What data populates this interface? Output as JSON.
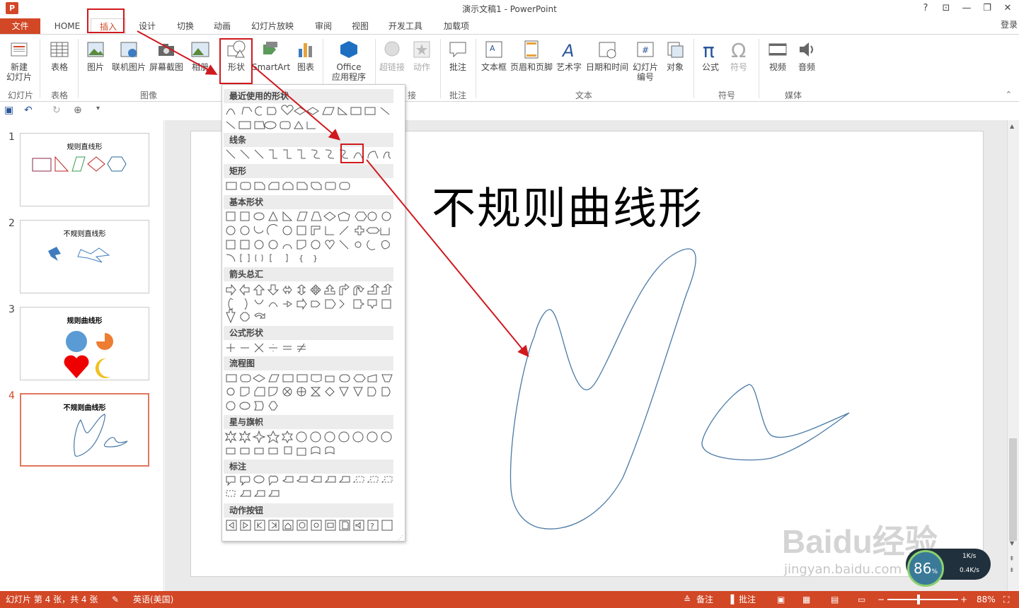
{
  "titlebar": {
    "app_icon": "P",
    "title": "演示文稿1 - PowerPoint",
    "help": "?",
    "restore_ribbon": "⊡",
    "minimize": "—",
    "maximize": "❐",
    "close": "✕"
  },
  "tabs": {
    "file": "文件",
    "home": "HOME",
    "insert": "插入",
    "design": "设计",
    "transitions": "切换",
    "animations": "动画",
    "slideshow": "幻灯片放映",
    "review": "审阅",
    "view": "视图",
    "developer": "开发工具",
    "addins": "加载项",
    "login": "登录"
  },
  "ribbon": {
    "new_slide": "新建",
    "new_slide2": "幻灯片",
    "table": "表格",
    "picture": "图片",
    "online_picture": "联机图片",
    "screenshot": "屏幕截图",
    "album": "相册",
    "shapes": "形状",
    "smartart": "SmartArt",
    "chart": "图表",
    "office_app": "Office",
    "office_app2": "应用程序",
    "hyperlink": "超链接",
    "action": "动作",
    "comment": "批注",
    "textbox": "文本框",
    "header_footer": "页眉和页脚",
    "wordart": "艺术字",
    "datetime": "日期和时间",
    "slide_number": "幻灯片",
    "slide_number2": "编号",
    "object": "对象",
    "equation": "公式",
    "symbol": "符号",
    "video": "视频",
    "audio": "音频",
    "groups": {
      "slides": "幻灯片",
      "tables": "表格",
      "images": "图像",
      "links": "接",
      "comments": "批注",
      "text": "文本",
      "symbols": "符号",
      "media": "媒体"
    }
  },
  "shapes_panel": {
    "sections": [
      "最近使用的形状",
      "线条",
      "矩形",
      "基本形状",
      "箭头总汇",
      "公式形状",
      "流程图",
      "星与旗帜",
      "标注",
      "动作按钮"
    ]
  },
  "thumbnails": [
    {
      "num": "1",
      "title": "规则直线形"
    },
    {
      "num": "2",
      "title": "不规则直线形"
    },
    {
      "num": "3",
      "title": "规则曲线形"
    },
    {
      "num": "4",
      "title": "不规则曲线形"
    }
  ],
  "slide": {
    "title": "不规则曲线形"
  },
  "statusbar": {
    "slide_info": "幻灯片 第 4 张，共 4 张",
    "language": "英语(美国)",
    "notes": "备注",
    "comments": "批注",
    "zoom": "88%"
  },
  "speed_widget": {
    "percent": "86",
    "up": "1K/s",
    "down": "0.4K/s"
  },
  "watermark": {
    "line1": "Baidu经验",
    "line2": "jingyan.baidu.com"
  },
  "colors": {
    "accent": "#d24726",
    "highlight": "#d0191e",
    "curve": "#4a7aa6"
  }
}
